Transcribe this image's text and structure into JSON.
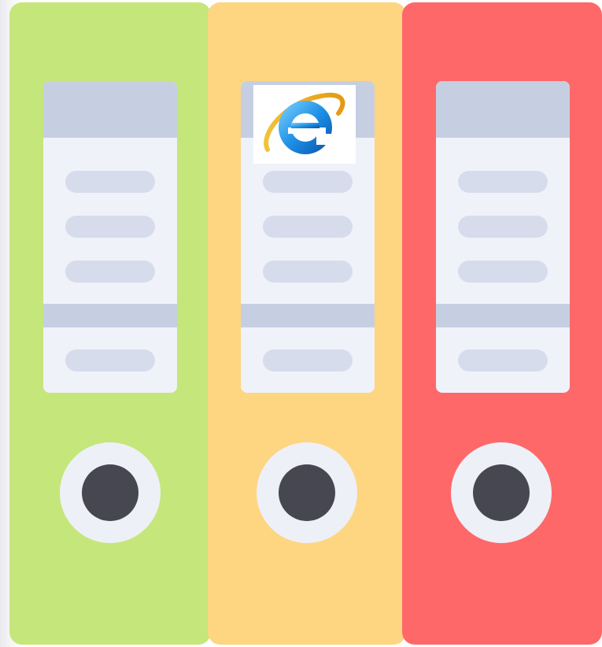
{
  "binders": [
    {
      "id": "green",
      "color": "#c5e67a"
    },
    {
      "id": "yellow",
      "color": "#fed580"
    },
    {
      "id": "red",
      "color": "#fe6869"
    }
  ],
  "label_card": {
    "background": "#f0f2f9",
    "header_color": "#c6cfe2",
    "line_color": "#d7dcec",
    "lines_per_card": 4
  },
  "ring": {
    "outer_color": "#eef0f8",
    "hole_color": "#474752"
  },
  "overlay_icon": {
    "name": "internet-explorer-icon",
    "on_binder": "yellow"
  }
}
